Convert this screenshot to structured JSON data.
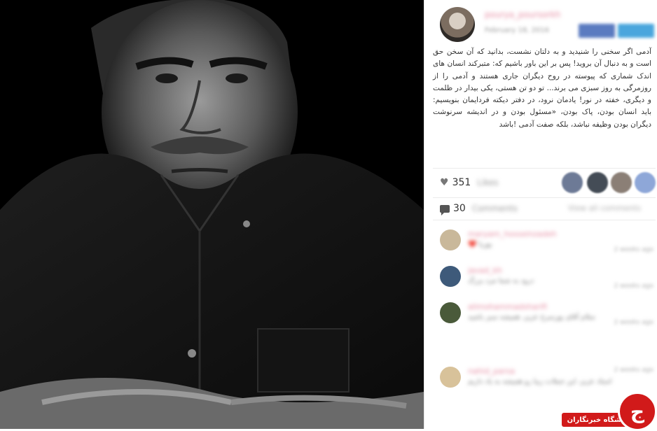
{
  "post": {
    "username": "pourya_poursorkh",
    "date": "February 18, 2016",
    "share": {
      "facebook": "Share",
      "twitter": "Tweet"
    },
    "caption": "آدمی اگر سخنی را شنیدید و به دلتان نشست، بدانید که آن سخن حق است و به دنبال آن بروید! پس بر این باور باشیم که: متبرکند انسان های اندک شماری که پیوسته در روح دیگران جاری هستند و آدمی را از روزمرگی به روز سبزی می برند... تو دو تن هستی، یکی بیدار در ظلمت و دیگری، خفته در نور! یادمان نرود، در دفتر دیکته فردایمان بنویسیم: باید انسان بودن، پاک بودن، «مسئول بودن و در اندیشه سرنوشت دیگران بودن وظیفه نباشد، بلکه صفت آدمی !باشد",
    "likes_count": "351",
    "likes_word": "Likes",
    "comments_count": "30",
    "comments_word": "Comments",
    "view_all": "View all comments",
    "icons": {
      "like": "heart-icon",
      "comment": "comment-bubble-icon"
    }
  },
  "comments": [
    {
      "username": "maryam_hosseinzadeh",
      "text": "❤️ پوریا",
      "date": "2 weeks ago"
    },
    {
      "username": "javad_kh",
      "text": "درود به شما مرد بزرگ",
      "date": "2 weeks ago"
    },
    {
      "username": "alimohammadsharifi",
      "text": "سلام آقای پورسرخ عزیز، همیشه سبز باشید",
      "date": "2 weeks ago"
    },
    {
      "username": "nahid_parsa",
      "text": "استاد عزیز، این جملات زیبا رو همیشه به یاد داریم",
      "date": "2 weeks ago"
    }
  ],
  "watermark": {
    "brand": "باشگاه خبرنگاران",
    "logo_letter": "ج"
  }
}
